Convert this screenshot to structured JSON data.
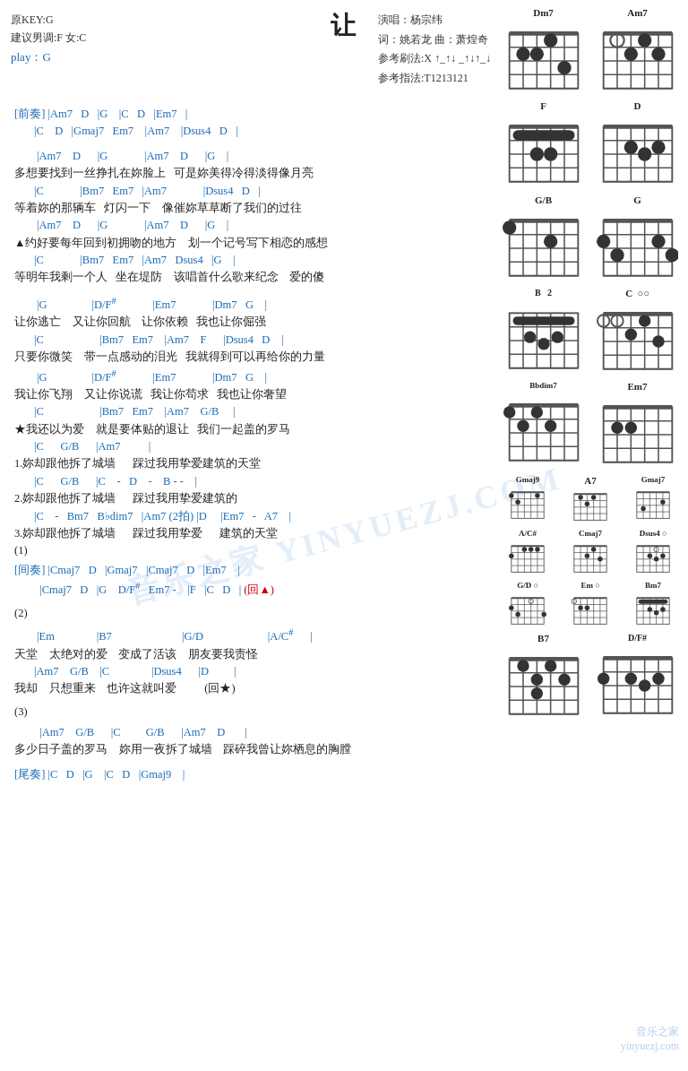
{
  "title": "让",
  "meta_left": {
    "key": "原KEY:G",
    "suggest": "建议男调:F 女:C",
    "play": "play：G"
  },
  "meta_right": {
    "singer": "演唱：杨宗纬",
    "lyricist": "词：姚若龙  曲：萧煌奇",
    "strum": "参考刷法:X ↑_↑↓  _↑↓↑_↓",
    "fingering": "参考指法:T1213121"
  },
  "watermark": "音乐之家 YINYUEZJ.COM",
  "footer": "音乐之家\nyinyuezj.com"
}
